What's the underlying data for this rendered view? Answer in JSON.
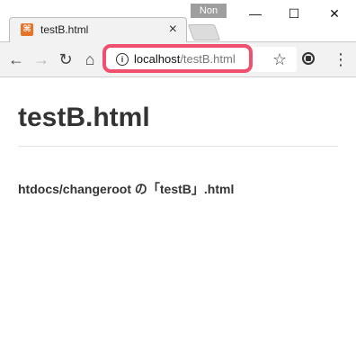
{
  "browser": {
    "tab": {
      "icon": "xampp-icon",
      "title": "testB.html",
      "close_glyph": "×"
    },
    "profile_badge": "Non",
    "window_controls": {
      "minimize": "—",
      "maximize": "☐",
      "close": "✕"
    },
    "toolbar": {
      "back_glyph": "←",
      "forward_glyph": "→",
      "reload_glyph": "↻",
      "home_glyph": "⌂",
      "url_host": "localhost",
      "url_path": "/testB.html",
      "star_glyph": "☆",
      "menu_glyph": "⋮"
    },
    "highlight_color": "#f0506e"
  },
  "page": {
    "title": "testB.html",
    "description": "htdocs/changeroot の「testB」.html"
  }
}
